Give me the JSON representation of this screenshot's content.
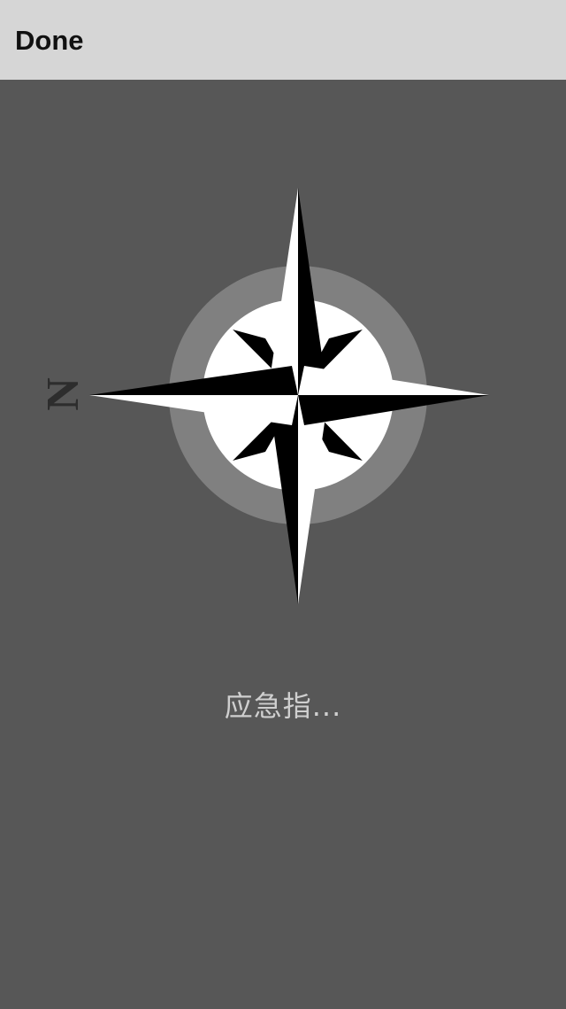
{
  "topbar": {
    "done_label": "Done"
  },
  "compass": {
    "north_letter": "N",
    "ring_color": "#808080",
    "face_color": "#ffffff",
    "point_dark_color": "#000000",
    "point_light_color": "#ffffff"
  },
  "status": {
    "text": "应急指..."
  },
  "colors": {
    "bar_background": "#d6d6d6",
    "page_background": "#575757",
    "status_text": "#cfcfcf"
  }
}
